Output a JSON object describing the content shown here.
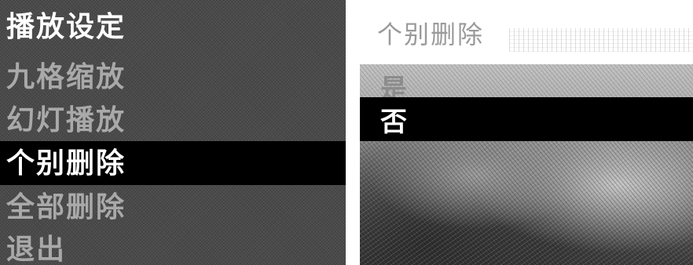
{
  "menu": {
    "title": "播放设定",
    "items": [
      {
        "label": "九格缩放",
        "selected": false
      },
      {
        "label": "幻灯播放",
        "selected": false
      },
      {
        "label": "个别删除",
        "selected": true
      },
      {
        "label": "全部删除",
        "selected": false
      },
      {
        "label": "退出",
        "selected": false
      }
    ]
  },
  "dialog": {
    "title": "个别删除",
    "options": [
      {
        "label": "是",
        "selected": false
      },
      {
        "label": "否",
        "selected": true
      }
    ]
  },
  "colors": {
    "menu_background": "#4a4a4a",
    "selection_background": "#000000",
    "selection_text": "#ffffff"
  }
}
